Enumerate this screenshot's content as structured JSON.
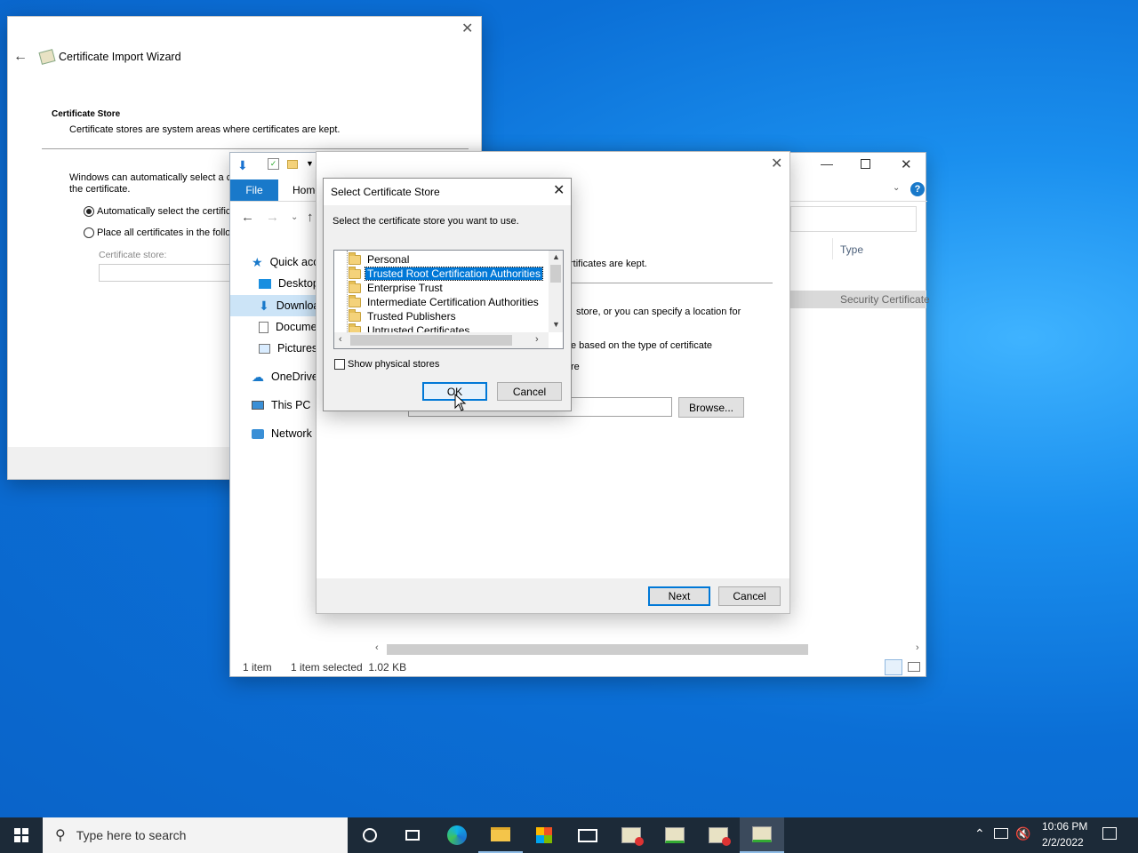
{
  "wizard": {
    "title": "Certificate Import Wizard",
    "section_title": "Certificate Store",
    "section_desc": "Certificate stores are system areas where certificates are kept.",
    "auto_text_line1": "Windows can automatically select a ce",
    "auto_text_line2": "the certificate.",
    "radio_auto": "Automatically select the certific",
    "radio_place": "Place all certificates in the follo",
    "store_label": "Certificate store:"
  },
  "explorer": {
    "ribbon_file": "File",
    "ribbon_home": "Home",
    "column_type": "Type",
    "file_type_value": "Security Certificate",
    "nav": [
      {
        "label": "Quick acc",
        "icon": "star-icon"
      },
      {
        "label": "Desktop",
        "icon": "desktop-icon"
      },
      {
        "label": "Downloa",
        "icon": "download-icon"
      },
      {
        "label": "Docume",
        "icon": "document-icon"
      },
      {
        "label": "Pictures",
        "icon": "pictures-icon"
      },
      {
        "label": "OneDrive",
        "icon": "cloud-icon"
      },
      {
        "label": "This PC",
        "icon": "computer-icon"
      },
      {
        "label": "Network",
        "icon": "network-icon"
      }
    ],
    "status_items": "1 item",
    "status_selected": "1 item selected  1.02 KB"
  },
  "wizard2": {
    "text_kept": "rtificates are kept.",
    "text_location": "store, or you can specify a location for",
    "text_based": "e based on the type of certificate",
    "text_re": "re",
    "browse_label": "Browse...",
    "next_label": "Next",
    "cancel_label": "Cancel"
  },
  "dialog": {
    "title": "Select Certificate Store",
    "instruction": "Select the certificate store you want to use.",
    "stores": [
      {
        "label": "Personal",
        "selected": false
      },
      {
        "label": "Trusted Root Certification Authorities",
        "selected": true
      },
      {
        "label": "Enterprise Trust",
        "selected": false
      },
      {
        "label": "Intermediate Certification Authorities",
        "selected": false
      },
      {
        "label": "Trusted Publishers",
        "selected": false
      },
      {
        "label": "Untrusted Certificates",
        "selected": false
      }
    ],
    "show_physical": "Show physical stores",
    "ok_label": "OK",
    "cancel_label": "Cancel"
  },
  "taskbar": {
    "search_placeholder": "Type here to search",
    "time": "10:06 PM",
    "date": "2/2/2022"
  },
  "colors": {
    "accent": "#0078d7",
    "desktop_blue": "#0a63c8",
    "taskbar": "#1c2a38"
  }
}
